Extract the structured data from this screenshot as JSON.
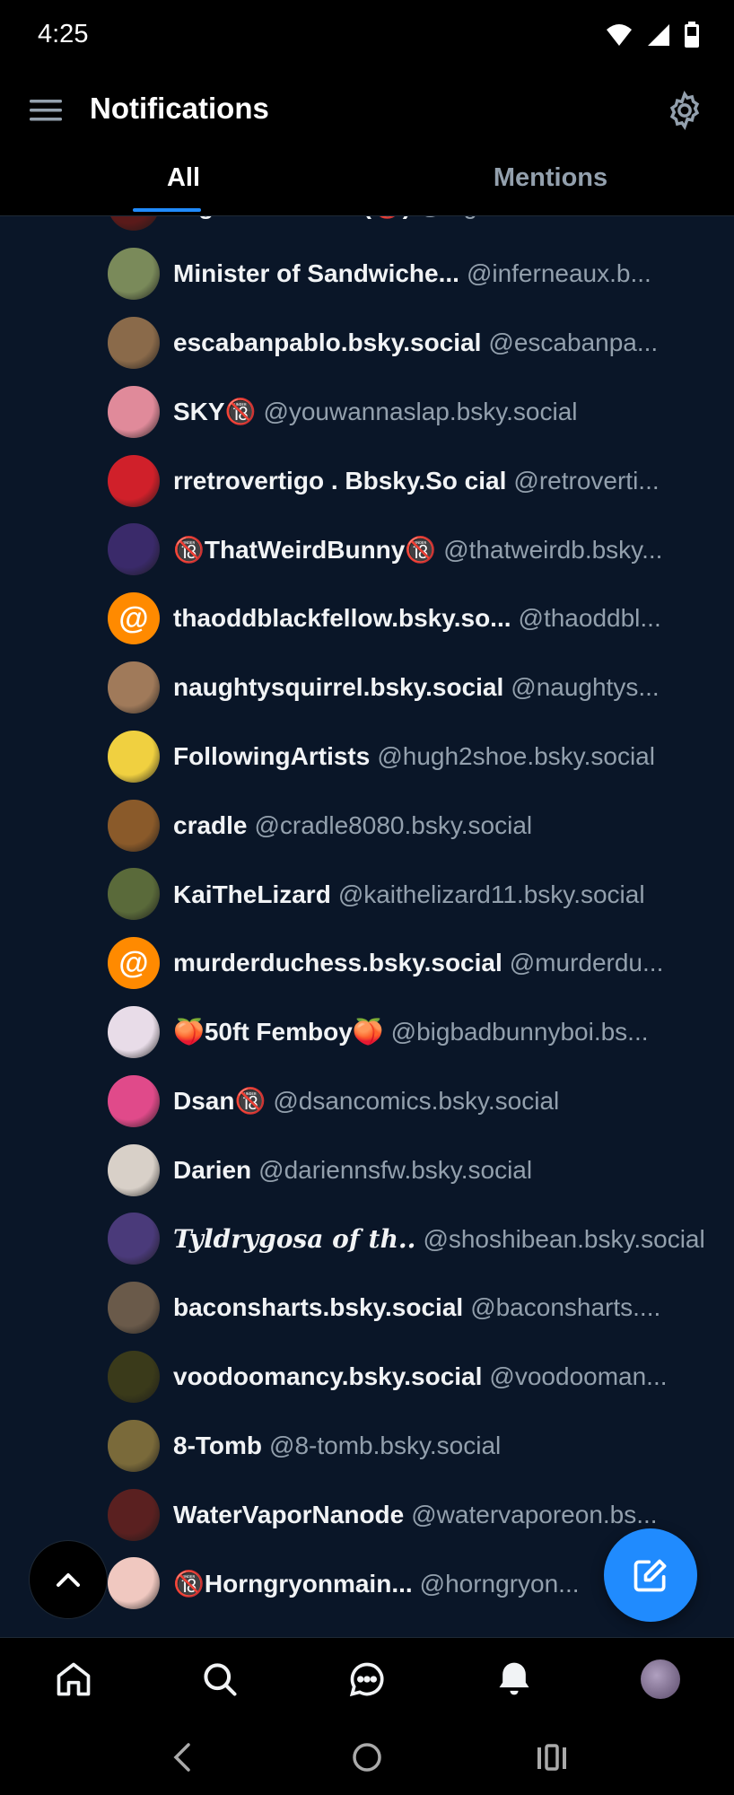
{
  "status_bar": {
    "time": "4:25"
  },
  "header": {
    "title": "Notifications",
    "tabs": [
      {
        "label": "All",
        "active": true
      },
      {
        "label": "Mentions",
        "active": false
      }
    ]
  },
  "users": [
    {
      "name": "NightStrikerRex(🔞)",
      "handle": "@nightstrikerrex.bs...",
      "avatar_color": "#5a1a1a"
    },
    {
      "name": "Minister of Sandwiche...",
      "handle": "@inferneaux.b...",
      "avatar_color": "#7a8a5a"
    },
    {
      "name": "escabanpablo.bsky.social",
      "handle": "@escabanpa...",
      "avatar_color": "#8a6a4a"
    },
    {
      "name": "SKY🔞",
      "handle": "@youwannaslap.bsky.social",
      "avatar_color": "#e08a9a"
    },
    {
      "name": "rretrovertigo . Bbsky.So cial",
      "handle": "@retroverti...",
      "avatar_color": "#d0202a"
    },
    {
      "name": "🔞ThatWeirdBunny🔞",
      "handle": "@thatweirdb.bsky...",
      "avatar_color": "#3a2a6a"
    },
    {
      "name": "thaoddblackfellow.bsky.so...",
      "handle": "@thaoddbl...",
      "avatar_color": "#ff8a00",
      "avatar_type": "at"
    },
    {
      "name": "naughtysquirrel.bsky.social",
      "handle": "@naughtys...",
      "avatar_color": "#a07a5a"
    },
    {
      "name": "FollowingArtists",
      "handle": "@hugh2shoe.bsky.social",
      "avatar_color": "#f0d040"
    },
    {
      "name": "cradle",
      "handle": "@cradle8080.bsky.social",
      "avatar_color": "#8a5a2a"
    },
    {
      "name": "KaiTheLizard",
      "handle": "@kaithelizard11.bsky.social",
      "avatar_color": "#5a6a3a"
    },
    {
      "name": "murderduchess.bsky.social",
      "handle": "@murderdu...",
      "avatar_color": "#ff8a00",
      "avatar_type": "at"
    },
    {
      "name": "🍑50ft Femboy🍑",
      "handle": "@bigbadbunnyboi.bs...",
      "avatar_color": "#e8dce8"
    },
    {
      "name": "Dsan🔞",
      "handle": "@dsancomics.bsky.social",
      "avatar_color": "#e04a8a"
    },
    {
      "name": "Darien",
      "handle": "@dariennsfw.bsky.social",
      "avatar_color": "#d8d0c8"
    },
    {
      "name": "Tyldrygosa of th..",
      "handle": "@shoshibean.bsky.social",
      "avatar_color": "#4a3a7a",
      "cursive": true
    },
    {
      "name": "baconsharts.bsky.social",
      "handle": "@baconsharts....",
      "avatar_color": "#6a5a4a"
    },
    {
      "name": "voodoomancy.bsky.social",
      "handle": "@voodooman...",
      "avatar_color": "#3a3a1a"
    },
    {
      "name": "8-Tomb",
      "handle": "@8-tomb.bsky.social",
      "avatar_color": "#7a6a3a"
    },
    {
      "name": "WaterVaporNanode",
      "handle": "@watervaporeon.bs...",
      "avatar_color": "#5a2020"
    },
    {
      "name": "🔞Horngryonmain...",
      "handle": "@horngryon...",
      "avatar_color": "#f0c8c0"
    }
  ],
  "icons": {
    "menu": "menu-icon",
    "settings": "gear-icon",
    "scroll_top": "chevron-up-icon",
    "compose": "compose-icon",
    "home": "home-icon",
    "search": "search-icon",
    "chat": "chat-icon",
    "notifications": "bell-icon",
    "profile": "avatar"
  },
  "colors": {
    "accent": "#208bfe",
    "feed_bg": "#0a1628",
    "handle": "#93a0ad"
  }
}
